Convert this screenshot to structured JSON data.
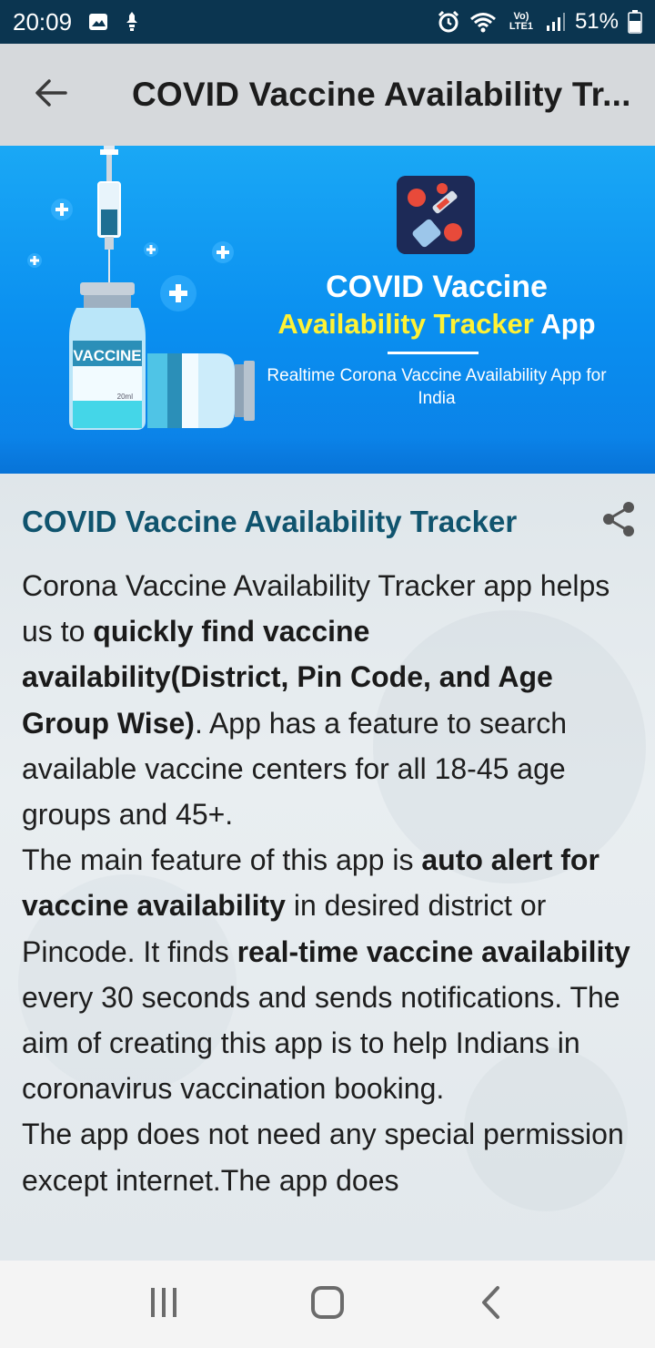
{
  "status_bar": {
    "time": "20:09",
    "battery": "51%",
    "network": "Vo) LTE1"
  },
  "app_bar": {
    "title": "COVID Vaccine Availability Tr..."
  },
  "banner": {
    "heading_line1": "COVID Vaccine",
    "heading_line2_highlight": "Availability Tracker",
    "heading_line2_rest": " App",
    "subtitle": "Realtime Corona Vaccine Availability App for India",
    "vial_label": "VACCINE",
    "vial_small": "20ml"
  },
  "content": {
    "title": "COVID Vaccine Availability Tracker",
    "description": [
      {
        "text": "Corona Vaccine Availability Tracker app helps us to ",
        "bold": false
      },
      {
        "text": "quickly find vaccine availability(District, Pin Code, and Age Group Wise)",
        "bold": true
      },
      {
        "text": ". App has a feature to search available vaccine centers for all 18-45 age groups and 45+.",
        "bold": false
      },
      {
        "text": "The main feature of this app is ",
        "bold": false,
        "newline": true
      },
      {
        "text": "auto alert for vaccine availability",
        "bold": true
      },
      {
        "text": " in desired district or Pincode. It finds ",
        "bold": false
      },
      {
        "text": "real-time vaccine availability",
        "bold": true
      },
      {
        "text": " every 30 seconds and sends notifications. The aim of creating this app is to help Indians in coronavirus vaccination booking.",
        "bold": false
      },
      {
        "text": "The app does not need any special permission except internet.The app does",
        "bold": false,
        "newline": true
      }
    ]
  },
  "colors": {
    "status_bar_bg": "#0b3550",
    "app_bar_bg": "#d6d9dc",
    "title_color": "#10546e",
    "banner_blue": "#0a8ff0",
    "banner_yellow": "#fff235"
  },
  "icons": {
    "back": "arrow-left-icon",
    "share": "share-icon",
    "nav_recents": "recents-icon",
    "nav_home": "home-icon",
    "nav_back": "back-icon"
  }
}
